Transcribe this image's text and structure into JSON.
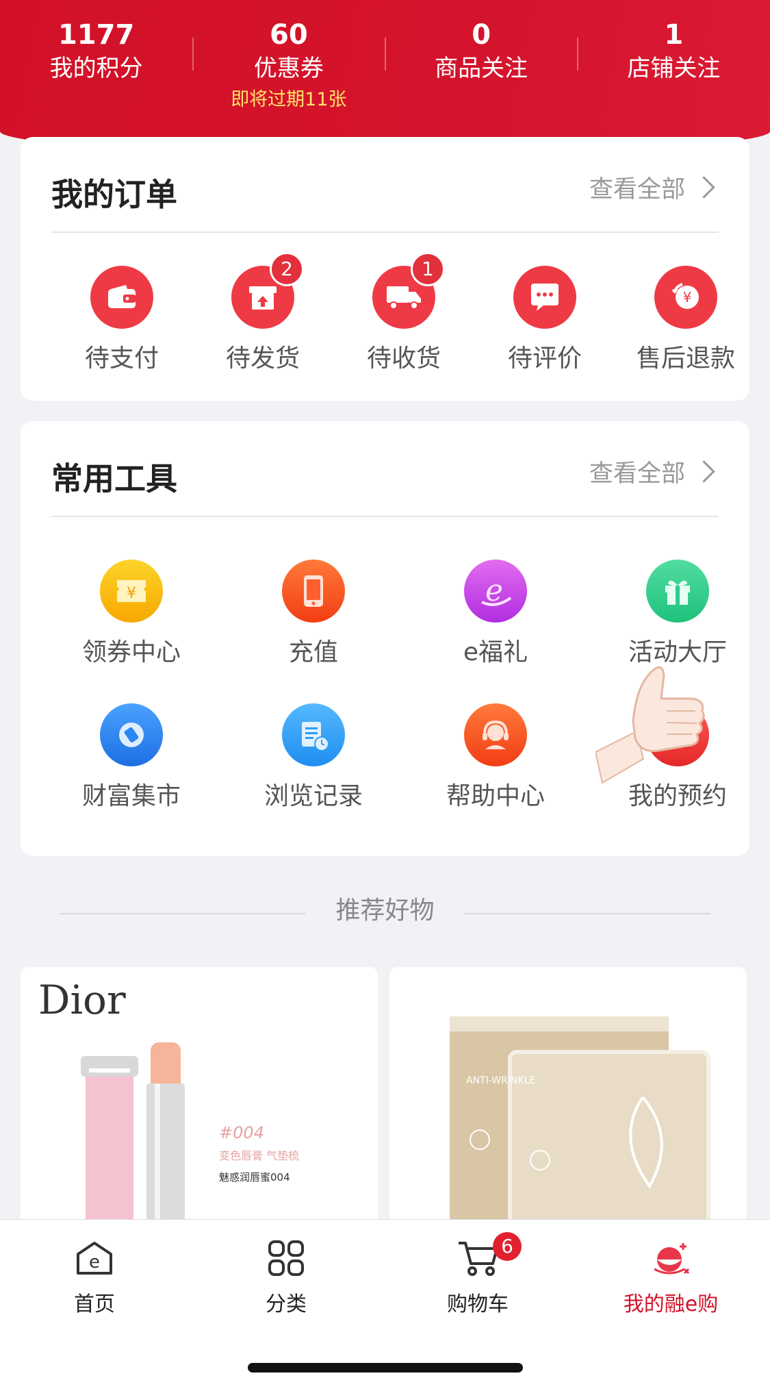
{
  "stats": [
    {
      "value": "1177",
      "label": "我的积分",
      "sub": ""
    },
    {
      "value": "60",
      "label": "优惠券",
      "sub": "即将过期11张"
    },
    {
      "value": "0",
      "label": "商品关注",
      "sub": ""
    },
    {
      "value": "1",
      "label": "店铺关注",
      "sub": ""
    }
  ],
  "orders": {
    "title": "我的订单",
    "view_all": "查看全部",
    "items": [
      {
        "label": "待支付",
        "icon": "wallet-icon",
        "badge": ""
      },
      {
        "label": "待发货",
        "icon": "box-upload-icon",
        "badge": "2"
      },
      {
        "label": "待收货",
        "icon": "truck-icon",
        "badge": "1"
      },
      {
        "label": "待评价",
        "icon": "chat-bubble-icon",
        "badge": ""
      },
      {
        "label": "售后退款",
        "icon": "refund-yen-icon",
        "badge": ""
      }
    ]
  },
  "tools": {
    "title": "常用工具",
    "view_all": "查看全部",
    "items": [
      {
        "label": "领券中心",
        "icon": "coupon-icon",
        "color": "#f7b500"
      },
      {
        "label": "充值",
        "icon": "phone-icon",
        "color": "#f5521e"
      },
      {
        "label": "e福礼",
        "icon": "e-gift-icon",
        "color": "#c43ee0"
      },
      {
        "label": "活动大厅",
        "icon": "gift-box-icon",
        "color": "#2fcc8a"
      },
      {
        "label": "财富集市",
        "icon": "wealth-icon",
        "color": "#2b86f0"
      },
      {
        "label": "浏览记录",
        "icon": "history-icon",
        "color": "#2f9df4"
      },
      {
        "label": "帮助中心",
        "icon": "headset-icon",
        "color": "#f5521e"
      },
      {
        "label": "我的预约",
        "icon": "calendar-clock-icon",
        "color": "#ee3a45"
      }
    ]
  },
  "recommend": {
    "title": "推荐好物",
    "products": [
      {
        "brand": "Dior",
        "shade": "#004",
        "line1": "变色唇膏 气垫梳",
        "line2": "魅惑润唇蜜004"
      },
      {
        "brand": "",
        "pack_text": "ANTI-WRINKLE"
      }
    ]
  },
  "tabbar": {
    "items": [
      {
        "label": "首页",
        "icon": "home-e-icon",
        "badge": ""
      },
      {
        "label": "分类",
        "icon": "grid-icon",
        "badge": ""
      },
      {
        "label": "购物车",
        "icon": "cart-icon",
        "badge": "6"
      },
      {
        "label": "我的融e购",
        "icon": "profile-mascot-icon",
        "badge": ""
      }
    ],
    "active_index": 3
  },
  "colors": {
    "brand_red": "#d21128",
    "coupon_yellow": "#ffe36a"
  }
}
